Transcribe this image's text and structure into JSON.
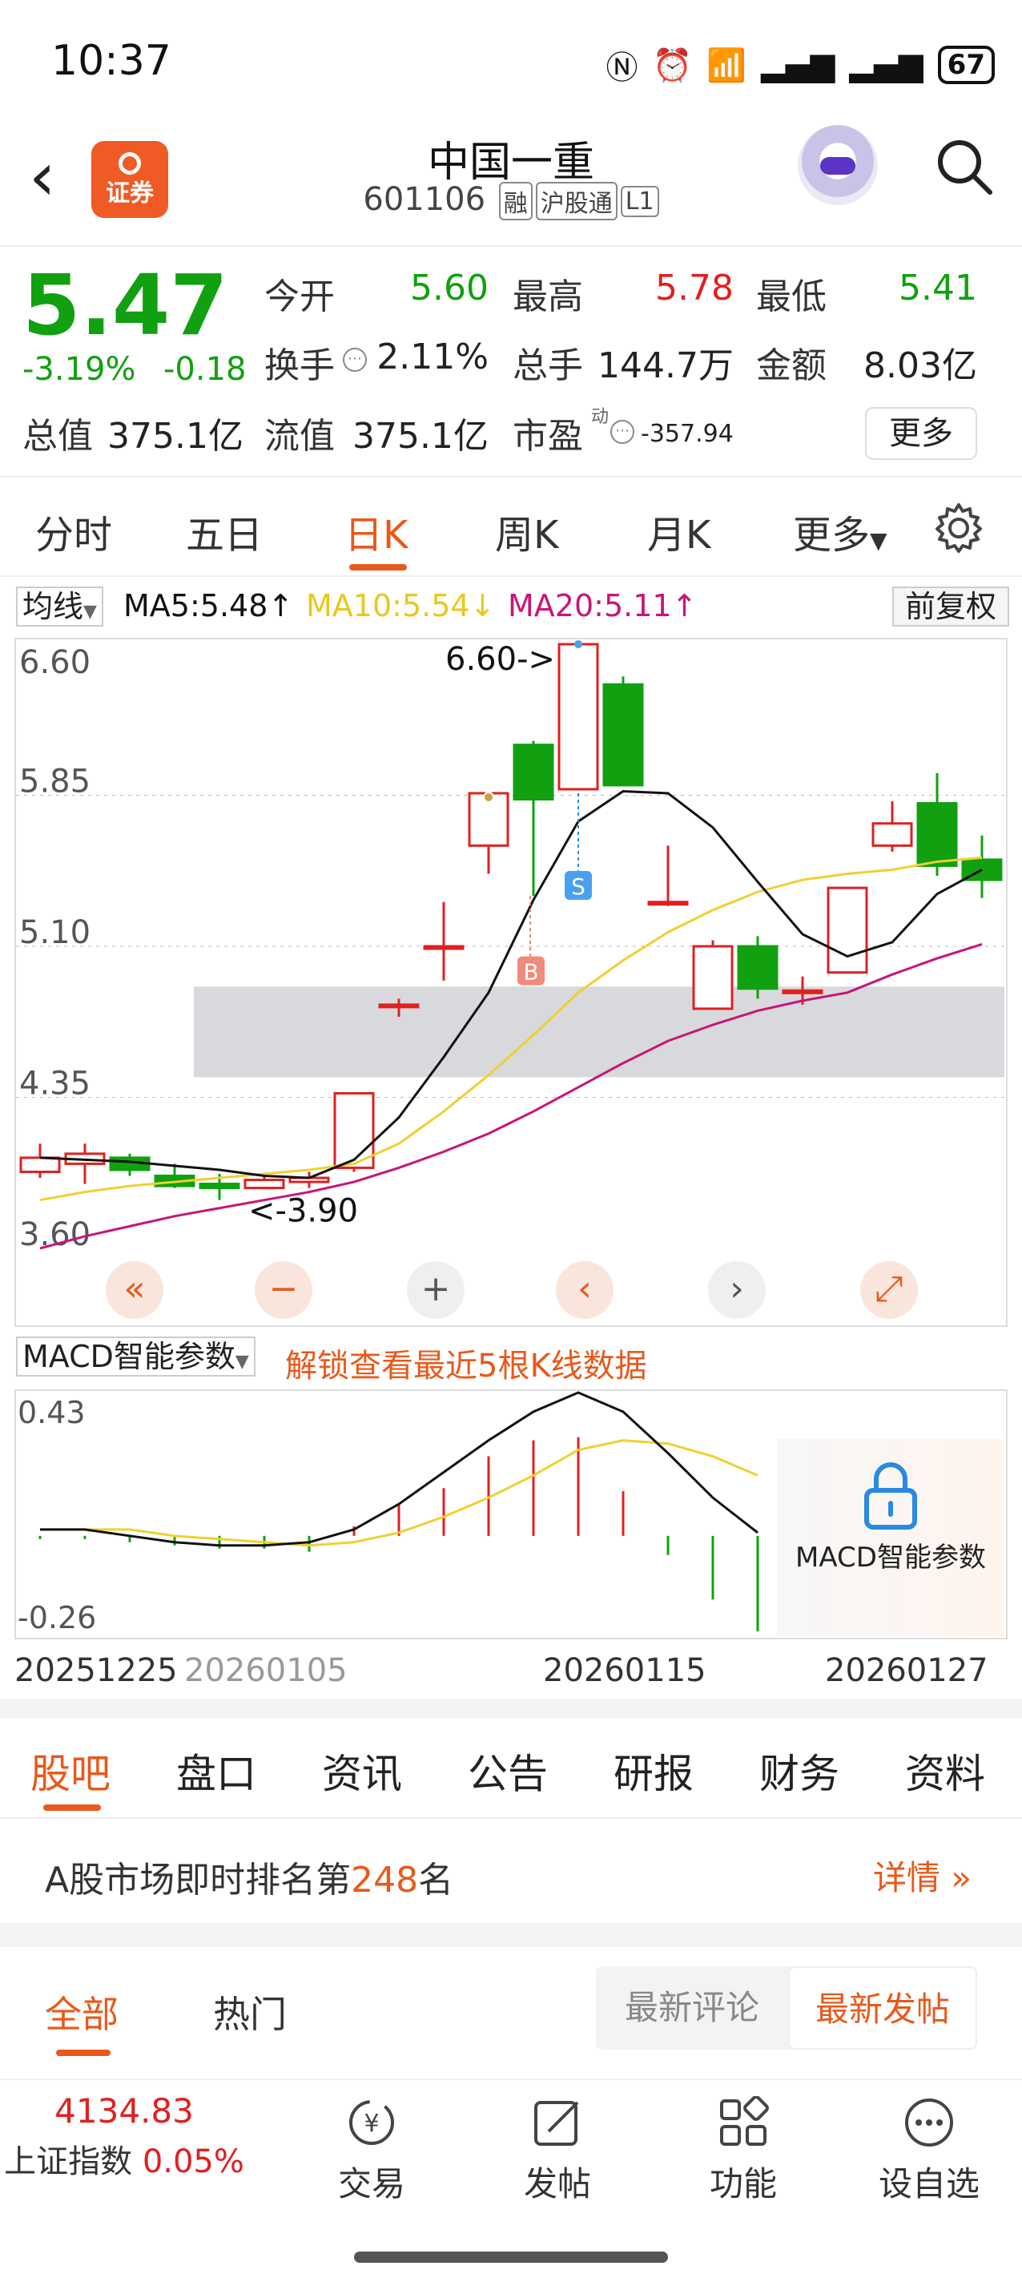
{
  "status": {
    "time": "10:37",
    "battery": "67"
  },
  "nav": {
    "title": "中国一重",
    "code": "601106",
    "tags": [
      "融",
      "沪股通",
      "L1"
    ],
    "logo_text": "证券"
  },
  "quote": {
    "price": "5.47",
    "change_pct": "-3.19%",
    "change": "-0.18",
    "open_label": "今开",
    "open": "5.60",
    "high_label": "最高",
    "high": "5.78",
    "low_label": "最低",
    "low": "5.41",
    "turnover_label": "换手",
    "turnover": "2.11%",
    "volume_label": "总手",
    "volume": "144.7万",
    "amount_label": "金额",
    "amount": "8.03亿",
    "mktcap_label": "总值",
    "mktcap": "375.1亿",
    "float_label": "流值",
    "float": "375.1亿",
    "pe_label": "市盈",
    "pe_sup": "动",
    "pe": "-357.94",
    "more": "更多"
  },
  "tabs": [
    "分时",
    "五日",
    "日K",
    "周K",
    "月K",
    "更多"
  ],
  "active_tab": "日K",
  "ma": {
    "button": "均线",
    "ma5": "MA5:5.48",
    "ma10": "MA10:5.54",
    "ma20": "MA20:5.11",
    "fq": "前复权"
  },
  "chart_data": {
    "type": "candlestick",
    "y_ticks": [
      "6.60",
      "5.85",
      "5.10",
      "4.35",
      "3.60"
    ],
    "ylim": [
      3.6,
      6.6
    ],
    "x_ticks": [
      "20251225",
      "20260105",
      "20260115",
      "20260127"
    ],
    "candles": [
      {
        "o": 3.98,
        "c": 4.05,
        "h": 4.12,
        "l": 3.95
      },
      {
        "o": 4.02,
        "c": 4.07,
        "h": 4.12,
        "l": 3.92
      },
      {
        "o": 4.05,
        "c": 3.99,
        "h": 4.07,
        "l": 3.96
      },
      {
        "o": 3.96,
        "c": 3.91,
        "h": 4.02,
        "l": 3.9
      },
      {
        "o": 3.92,
        "c": 3.9,
        "h": 3.97,
        "l": 3.84
      },
      {
        "o": 3.9,
        "c": 3.94,
        "h": 3.97,
        "l": 3.9
      },
      {
        "o": 3.93,
        "c": 3.95,
        "h": 3.98,
        "l": 3.9
      },
      {
        "o": 4.0,
        "c": 4.37,
        "h": 4.37,
        "l": 3.98
      },
      {
        "o": 4.81,
        "c": 4.81,
        "h": 4.84,
        "l": 4.75
      },
      {
        "o": 5.1,
        "c": 5.1,
        "h": 5.32,
        "l": 4.93
      },
      {
        "o": 5.6,
        "c": 5.86,
        "h": 5.86,
        "l": 5.46
      },
      {
        "o": 6.1,
        "c": 5.83,
        "h": 6.12,
        "l": 5.35
      },
      {
        "o": 5.88,
        "c": 6.6,
        "h": 6.6,
        "l": 5.88
      },
      {
        "o": 6.4,
        "c": 5.9,
        "h": 6.44,
        "l": 5.9
      },
      {
        "o": 5.32,
        "c": 5.32,
        "h": 5.6,
        "l": 5.3
      },
      {
        "o": 4.79,
        "c": 5.1,
        "h": 5.13,
        "l": 4.79
      },
      {
        "o": 5.1,
        "c": 4.89,
        "h": 5.15,
        "l": 4.84
      },
      {
        "o": 4.88,
        "c": 4.88,
        "h": 4.95,
        "l": 4.81
      },
      {
        "o": 4.97,
        "c": 5.39,
        "h": 5.39,
        "l": 4.97
      },
      {
        "o": 5.6,
        "c": 5.71,
        "h": 5.82,
        "l": 5.57
      },
      {
        "o": 5.81,
        "c": 5.5,
        "h": 5.96,
        "l": 5.45
      },
      {
        "o": 5.53,
        "c": 5.43,
        "h": 5.65,
        "l": 5.34
      }
    ],
    "ma5": [
      4.05,
      4.04,
      4.03,
      4.01,
      3.99,
      3.96,
      3.95,
      4.04,
      4.25,
      4.55,
      4.87,
      5.33,
      5.72,
      5.87,
      5.86,
      5.69,
      5.42,
      5.16,
      5.05,
      5.12,
      5.36,
      5.48
    ],
    "ma10": [
      3.84,
      3.88,
      3.91,
      3.93,
      3.95,
      3.97,
      3.99,
      4.02,
      4.12,
      4.28,
      4.46,
      4.66,
      4.87,
      5.03,
      5.17,
      5.28,
      5.37,
      5.43,
      5.46,
      5.48,
      5.52,
      5.54
    ],
    "ma20": [
      3.6,
      3.66,
      3.71,
      3.76,
      3.8,
      3.84,
      3.88,
      3.93,
      4.0,
      4.08,
      4.17,
      4.28,
      4.4,
      4.52,
      4.63,
      4.71,
      4.78,
      4.83,
      4.87,
      4.96,
      5.04,
      5.11
    ],
    "labels": {
      "high_mark": "6.60->",
      "low_mark": "<-3.90",
      "buy": "B",
      "sell": "S"
    }
  },
  "macd": {
    "title": "MACD智能参数",
    "notice": "解锁查看最近5根K线数据",
    "lock_label": "MACD智能参数",
    "y_ticks": [
      "0.43",
      "-0.26"
    ],
    "ylim": [
      -0.3,
      0.43
    ],
    "dif": [
      0.02,
      0.02,
      0.0,
      -0.02,
      -0.03,
      -0.03,
      -0.02,
      0.02,
      0.1,
      0.2,
      0.3,
      0.39,
      0.45,
      0.39,
      0.26,
      0.12,
      0.01
    ],
    "dea": [
      0.02,
      0.02,
      0.02,
      0.0,
      -0.01,
      -0.02,
      -0.03,
      -0.02,
      0.01,
      0.06,
      0.12,
      0.19,
      0.27,
      0.3,
      0.29,
      0.25,
      0.19
    ],
    "hist": [
      -0.01,
      -0.01,
      -0.02,
      -0.03,
      -0.04,
      -0.04,
      -0.05,
      0.03,
      0.1,
      0.15,
      0.25,
      0.3,
      0.31,
      0.14,
      -0.06,
      -0.2,
      -0.3
    ]
  },
  "subtabs": [
    "股吧",
    "盘口",
    "资讯",
    "公告",
    "研报",
    "财务",
    "资料"
  ],
  "rank": {
    "prefix": "A股市场即时排名第",
    "num": "248",
    "suffix": "名",
    "detail": "详情"
  },
  "posts": {
    "all": "全部",
    "hot": "热门",
    "latest_comment": "最新评论",
    "latest_post": "最新发帖"
  },
  "bottom": {
    "index_value": "4134.83",
    "index_name": "上证指数",
    "index_change": "0.05%",
    "items": [
      "交易",
      "发帖",
      "功能",
      "设自选"
    ]
  },
  "colors": {
    "up": "#e02020",
    "down": "#10a010",
    "accent": "#e8591a",
    "ma5": "#111111",
    "ma10": "#f0d030",
    "ma20": "#c8147a"
  }
}
